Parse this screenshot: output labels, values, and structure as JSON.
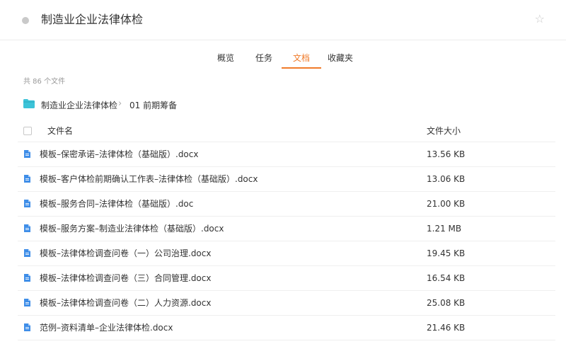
{
  "header": {
    "title": "制造业企业法律体检"
  },
  "tabs": [
    {
      "label": "概览",
      "active": false
    },
    {
      "label": "任务",
      "active": false
    },
    {
      "label": "文档",
      "active": true
    },
    {
      "label": "收藏夹",
      "active": false
    }
  ],
  "file_count_text": "共 86 个文件",
  "breadcrumb": {
    "root": "制造业企业法律体检",
    "current": "01 前期筹备"
  },
  "table": {
    "col_name": "文件名",
    "col_size": "文件大小",
    "rows": [
      {
        "name": "模板–保密承诺–法律体检（基础版）.docx",
        "size": "13.56 KB"
      },
      {
        "name": "模板–客户体检前期确认工作表–法律体检（基础版）.docx",
        "size": "13.06 KB"
      },
      {
        "name": "模板–服务合同–法律体检（基础版）.doc",
        "size": "21.00 KB"
      },
      {
        "name": "模板–服务方案–制造业法律体检（基础版）.docx",
        "size": "1.21 MB"
      },
      {
        "name": "模板–法律体检调查问卷（一）公司治理.docx",
        "size": "19.45 KB"
      },
      {
        "name": "模板–法律体检调查问卷（三）合同管理.docx",
        "size": "16.54 KB"
      },
      {
        "name": "模板–法律体检调查问卷（二）人力资源.docx",
        "size": "25.08 KB"
      },
      {
        "name": "范例–资料清单–企业法律体检.docx",
        "size": "21.46 KB"
      }
    ]
  },
  "colors": {
    "accent": "#f07b2a",
    "doc_icon": "#3f8ee8",
    "folder": "#3cc3d8"
  }
}
